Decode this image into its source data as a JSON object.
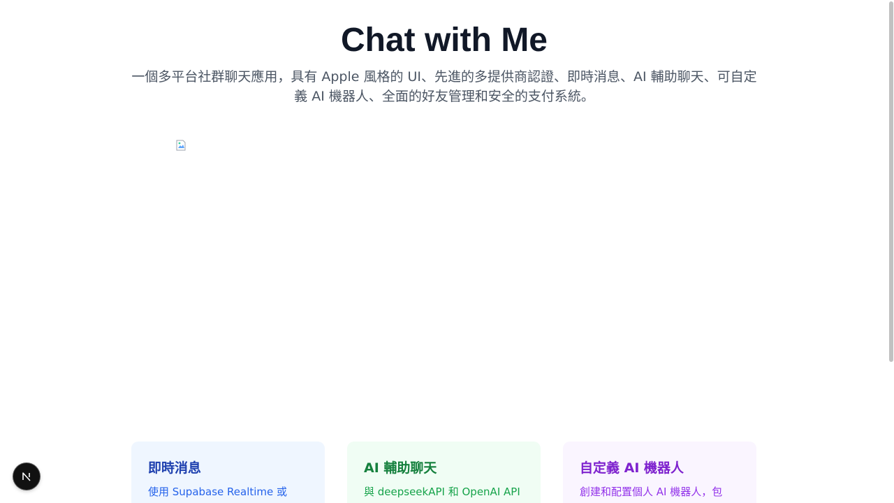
{
  "hero": {
    "title": "Chat with Me",
    "subtitle": "一個多平台社群聊天應用，具有 Apple 風格的 UI、先進的多提供商認證、即時消息、AI 輔助聊天、可自定義 AI 機器人、全面的好友管理和安全的支付系統。"
  },
  "features": [
    {
      "title": "即時消息",
      "description": "使用 Supabase Realtime 或",
      "color": "#2563eb"
    },
    {
      "title": "AI 輔助聊天",
      "description": "與 deepseekAPI 和 OpenAI API",
      "color": "#16a34a"
    },
    {
      "title": "自定義 AI 機器人",
      "description": "創建和配置個人 AI 機器人，包",
      "color": "#9333ea"
    }
  ],
  "icons": {
    "hero_image": "broken-image-icon",
    "dev_badge": "nextjs-logo-icon"
  },
  "colors": {
    "title": "#111827",
    "subtitle": "#4b5563"
  }
}
